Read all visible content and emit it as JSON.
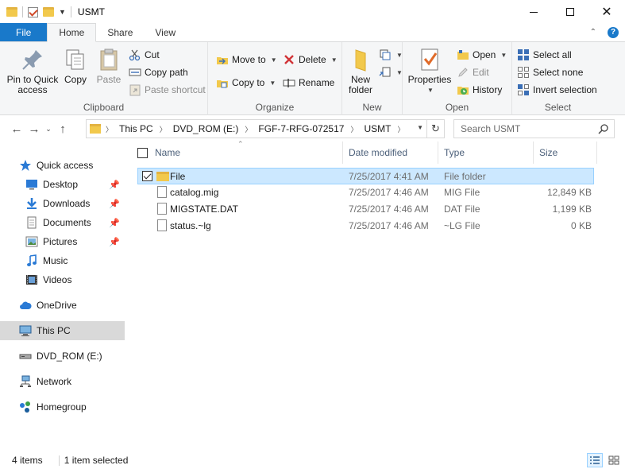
{
  "window": {
    "title": "USMT",
    "controls": {
      "minimize": "minimize",
      "maximize": "maximize",
      "close": "close"
    }
  },
  "ribbon_tabs": [
    {
      "label": "File",
      "style": "file"
    },
    {
      "label": "Home",
      "style": "active"
    },
    {
      "label": "Share",
      "style": ""
    },
    {
      "label": "View",
      "style": ""
    }
  ],
  "ribbon": {
    "clipboard": {
      "label": "Clipboard",
      "pin_to_quick_access": "Pin to Quick access",
      "copy": "Copy",
      "paste": "Paste",
      "cut": "Cut",
      "copy_path": "Copy path",
      "paste_shortcut": "Paste shortcut"
    },
    "organize": {
      "label": "Organize",
      "move_to": "Move to",
      "copy_to": "Copy to",
      "delete": "Delete",
      "rename": "Rename"
    },
    "new": {
      "label": "New",
      "new_folder": "New folder"
    },
    "open": {
      "label": "Open",
      "properties": "Properties",
      "open": "Open",
      "edit": "Edit",
      "history": "History"
    },
    "select": {
      "label": "Select",
      "select_all": "Select all",
      "select_none": "Select none",
      "invert_selection": "Invert selection"
    }
  },
  "address": {
    "breadcrumbs": [
      "This PC",
      "DVD_ROM (E:)",
      "FGF-7-RFG-072517",
      "USMT"
    ],
    "search_placeholder": "Search USMT"
  },
  "nav_pane": [
    {
      "label": "Quick access",
      "icon": "star-icon",
      "pinned": false,
      "selected": false
    },
    {
      "label": "Desktop",
      "icon": "desktop-icon",
      "pinned": true,
      "selected": false
    },
    {
      "label": "Downloads",
      "icon": "download-icon",
      "pinned": true,
      "selected": false
    },
    {
      "label": "Documents",
      "icon": "documents-icon",
      "pinned": true,
      "selected": false
    },
    {
      "label": "Pictures",
      "icon": "pictures-icon",
      "pinned": true,
      "selected": false
    },
    {
      "label": "Music",
      "icon": "music-icon",
      "pinned": false,
      "selected": false
    },
    {
      "label": "Videos",
      "icon": "videos-icon",
      "pinned": false,
      "selected": false
    },
    {
      "label": "OneDrive",
      "icon": "cloud-icon",
      "pinned": false,
      "selected": false
    },
    {
      "label": "This PC",
      "icon": "computer-icon",
      "pinned": false,
      "selected": true
    },
    {
      "label": "DVD_ROM (E:)",
      "icon": "drive-icon",
      "pinned": false,
      "selected": false
    },
    {
      "label": "Network",
      "icon": "network-icon",
      "pinned": false,
      "selected": false
    },
    {
      "label": "Homegroup",
      "icon": "homegroup-icon",
      "pinned": false,
      "selected": false
    }
  ],
  "columns": {
    "name": "Name",
    "date_modified": "Date modified",
    "type": "Type",
    "size": "Size"
  },
  "files": [
    {
      "name": "File",
      "date": "7/25/2017 4:41 AM",
      "type": "File folder",
      "size": "",
      "kind": "folder",
      "selected": true
    },
    {
      "name": "catalog.mig",
      "date": "7/25/2017 4:46 AM",
      "type": "MIG File",
      "size": "12,849 KB",
      "kind": "file",
      "selected": false
    },
    {
      "name": "MIGSTATE.DAT",
      "date": "7/25/2017 4:46 AM",
      "type": "DAT File",
      "size": "1,199 KB",
      "kind": "file",
      "selected": false
    },
    {
      "name": "status.~lg",
      "date": "7/25/2017 4:46 AM",
      "type": "~LG File",
      "size": "0 KB",
      "kind": "file",
      "selected": false
    }
  ],
  "status": {
    "item_count": "4 items",
    "selection": "1 item selected"
  },
  "colors": {
    "accent": "#1979ca",
    "selection_bg": "#cce8ff",
    "selection_border": "#99d1ff",
    "folder": "#f2c94c"
  }
}
